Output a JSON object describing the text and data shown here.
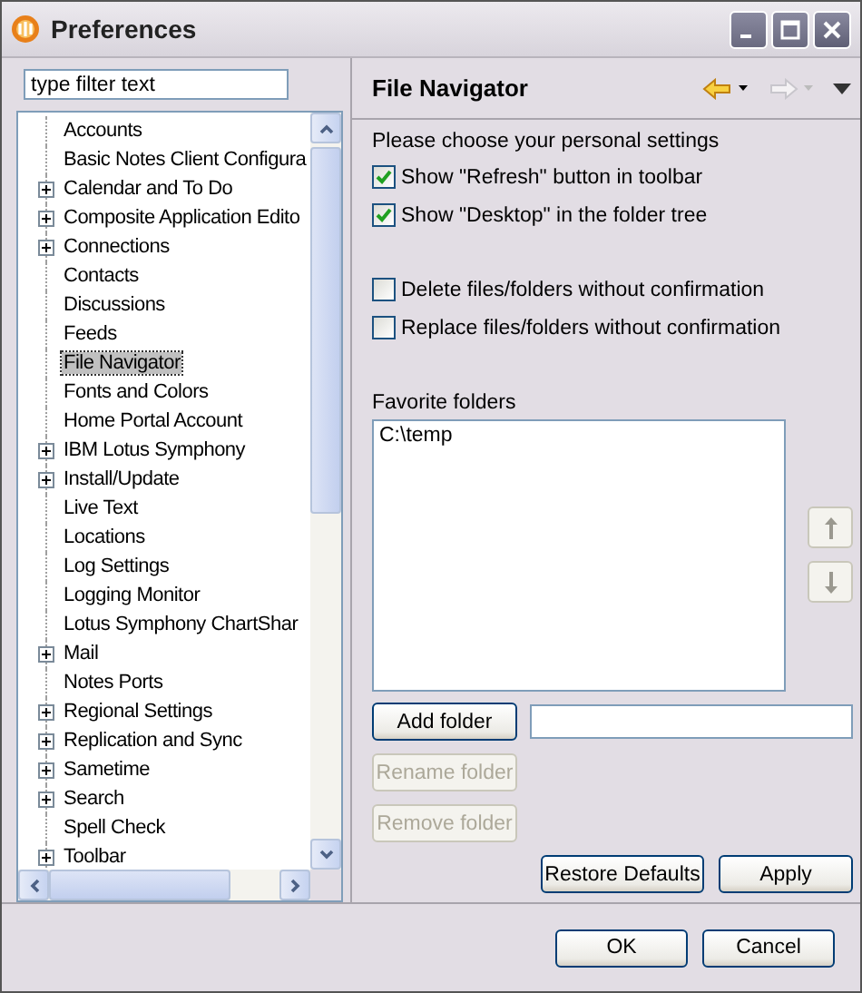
{
  "window": {
    "title": "Preferences"
  },
  "filter": {
    "placeholder": "type filter text"
  },
  "tree": [
    {
      "label": "Accounts",
      "expandable": false,
      "selected": false
    },
    {
      "label": "Basic Notes Client Configura",
      "expandable": false,
      "selected": false
    },
    {
      "label": "Calendar and To Do",
      "expandable": true,
      "selected": false
    },
    {
      "label": "Composite Application Edito",
      "expandable": true,
      "selected": false
    },
    {
      "label": "Connections",
      "expandable": true,
      "selected": false
    },
    {
      "label": "Contacts",
      "expandable": false,
      "selected": false
    },
    {
      "label": "Discussions",
      "expandable": false,
      "selected": false
    },
    {
      "label": "Feeds",
      "expandable": false,
      "selected": false
    },
    {
      "label": "File Navigator",
      "expandable": false,
      "selected": true
    },
    {
      "label": "Fonts and Colors",
      "expandable": false,
      "selected": false
    },
    {
      "label": "Home Portal Account",
      "expandable": false,
      "selected": false
    },
    {
      "label": "IBM Lotus Symphony",
      "expandable": true,
      "selected": false
    },
    {
      "label": "Install/Update",
      "expandable": true,
      "selected": false
    },
    {
      "label": "Live Text",
      "expandable": false,
      "selected": false
    },
    {
      "label": "Locations",
      "expandable": false,
      "selected": false
    },
    {
      "label": "Log Settings",
      "expandable": false,
      "selected": false
    },
    {
      "label": "Logging Monitor",
      "expandable": false,
      "selected": false
    },
    {
      "label": "Lotus Symphony ChartShar",
      "expandable": false,
      "selected": false
    },
    {
      "label": "Mail",
      "expandable": true,
      "selected": false
    },
    {
      "label": "Notes Ports",
      "expandable": false,
      "selected": false
    },
    {
      "label": "Regional Settings",
      "expandable": true,
      "selected": false
    },
    {
      "label": "Replication and Sync",
      "expandable": true,
      "selected": false
    },
    {
      "label": "Sametime",
      "expandable": true,
      "selected": false
    },
    {
      "label": "Search",
      "expandable": true,
      "selected": false
    },
    {
      "label": "Spell Check",
      "expandable": false,
      "selected": false
    },
    {
      "label": "Toolbar",
      "expandable": true,
      "selected": false
    }
  ],
  "page": {
    "title": "File Navigator",
    "intro": "Please choose your personal settings",
    "options": [
      {
        "label": "Show \"Refresh\" button in toolbar",
        "checked": true
      },
      {
        "label": "Show \"Desktop\" in the folder tree",
        "checked": true
      },
      {
        "label": "Delete files/folders without confirmation",
        "checked": false
      },
      {
        "label": "Replace files/folders without confirmation",
        "checked": false
      }
    ],
    "favorites_label": "Favorite folders",
    "favorites": [
      "C:\\temp"
    ],
    "folder_buttons": [
      {
        "label": "Add folder",
        "disabled": false
      },
      {
        "label": "Rename folder",
        "disabled": true
      },
      {
        "label": "Remove folder",
        "disabled": true
      }
    ],
    "move_buttons": [
      {
        "kind": "up",
        "disabled": true
      },
      {
        "kind": "down",
        "disabled": true
      }
    ],
    "page_buttons": [
      "Restore Defaults",
      "Apply"
    ]
  },
  "buttons": [
    "OK",
    "Cancel"
  ]
}
